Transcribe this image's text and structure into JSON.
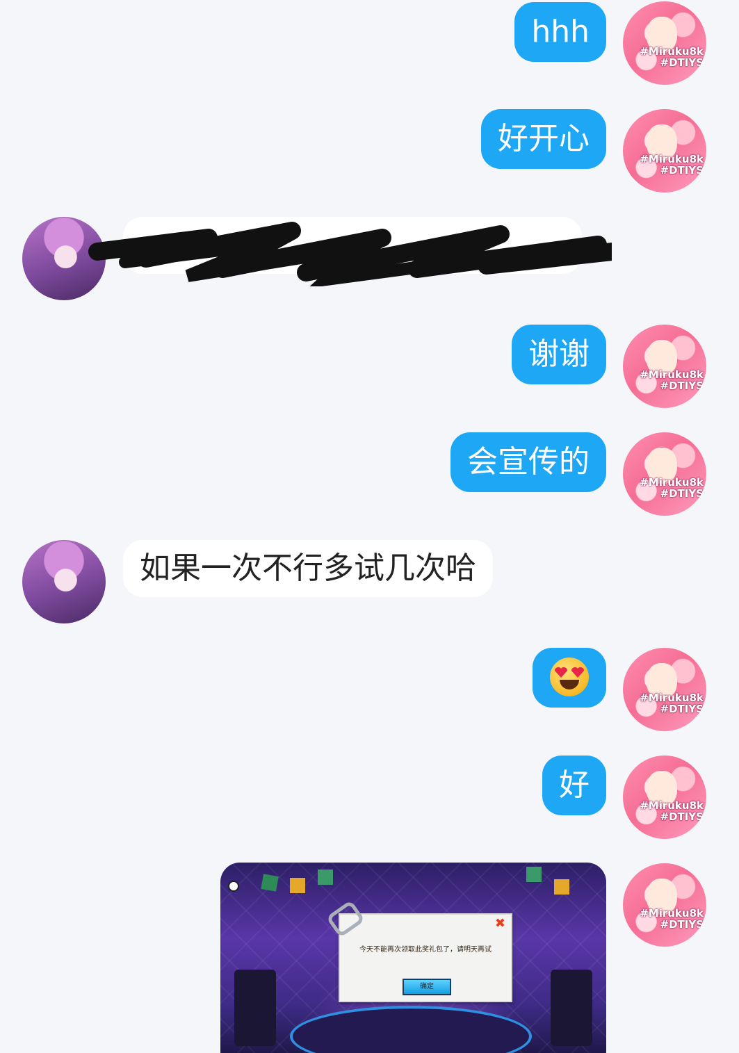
{
  "messages": [
    {
      "side": "me",
      "type": "text",
      "text": "hhh"
    },
    {
      "side": "me",
      "type": "text",
      "text": "好开心"
    },
    {
      "side": "other",
      "type": "redacted"
    },
    {
      "side": "me",
      "type": "text",
      "text": "谢谢"
    },
    {
      "side": "me",
      "type": "text",
      "text": "会宣传的"
    },
    {
      "side": "other",
      "type": "text",
      "text": "如果一次不行多试几次哈"
    },
    {
      "side": "me",
      "type": "emoji",
      "emoji": "smiling-face-with-heart-eyes"
    },
    {
      "side": "me",
      "type": "text",
      "text": "好"
    },
    {
      "side": "me",
      "type": "image",
      "image": {
        "dialog_message": "今天不能再次领取此奖礼包了，请明天再试",
        "dialog_button": "确定",
        "close_icon": "close-x-icon"
      }
    }
  ],
  "avatars": {
    "me": {
      "tag_line1": "#Miruku8k",
      "tag_line2": "#DTIYS"
    }
  },
  "colors": {
    "background": "#f4f6f9",
    "my_bubble": "#1ea7f5",
    "other_bubble": "#ffffff"
  }
}
